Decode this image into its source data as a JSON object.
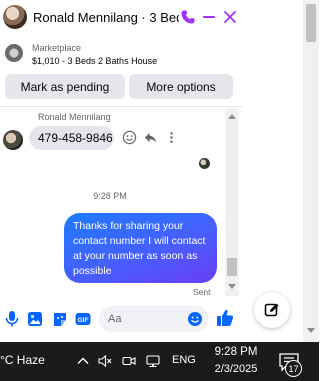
{
  "header": {
    "title": "Ronald Mennilang · 3 Beds…",
    "accent_color": "#a033ff"
  },
  "marketplace": {
    "label": "Marketplace",
    "listing": "$1,010 - 3 Beds 2 Baths House"
  },
  "actions": {
    "mark_pending": "Mark as pending",
    "more_options": "More options"
  },
  "thread": {
    "sender_name": "Ronald Mennilang",
    "incoming_message": "479-458-9846",
    "timestamp": "9:28 PM",
    "outgoing_message": "Thanks for sharing your contact number I will contact at your number as soon as possible",
    "status": "Sent"
  },
  "composer": {
    "placeholder": "Aa",
    "icons": [
      "mic-icon",
      "photo-icon",
      "sticker-icon",
      "gif-icon",
      "emoji-icon",
      "like-icon"
    ],
    "accent_color": "#0866ff"
  },
  "taskbar": {
    "weather": "°C  Haze",
    "language": "ENG",
    "time": "9:28 PM",
    "date": "2/3/2025",
    "notification_count": "17"
  }
}
